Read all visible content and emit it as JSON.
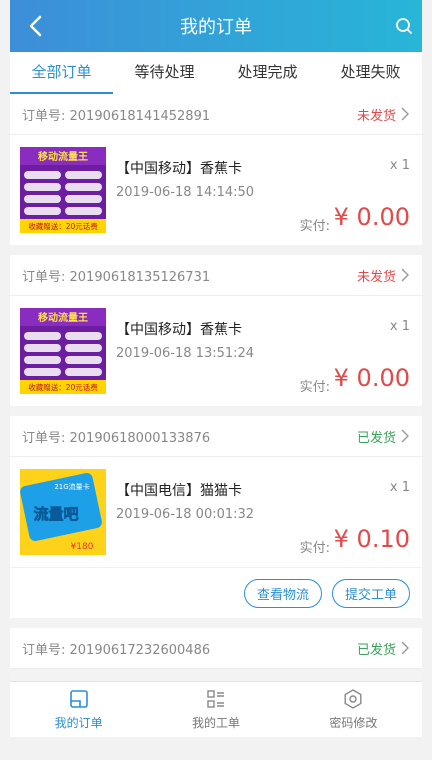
{
  "header": {
    "title": "我的订单"
  },
  "tabs": [
    "全部订单",
    "等待处理",
    "处理完成",
    "处理失败"
  ],
  "orders": [
    {
      "order_no": "订单号: 20190618141452891",
      "status": "未发货",
      "name": "【中国移动】香蕉卡",
      "date": "2019-06-18 14:14:50",
      "qty": "x 1",
      "pay_label": "实付:",
      "amount": "¥ 0.00",
      "thumb_title": "移动流量王",
      "thumb_bottom": "收藏赠送：20元话费"
    },
    {
      "order_no": "订单号: 20190618135126731",
      "status": "未发货",
      "name": "【中国移动】香蕉卡",
      "date": "2019-06-18 13:51:24",
      "qty": "x 1",
      "pay_label": "实付:",
      "amount": "¥ 0.00",
      "thumb_title": "移动流量王",
      "thumb_bottom": "收藏赠送：20元话费"
    },
    {
      "order_no": "订单号: 20190618000133876",
      "status": "已发货",
      "name": "【中国电信】猫猫卡",
      "date": "2019-06-18 00:01:32",
      "qty": "x 1",
      "pay_label": "实付:",
      "amount": "¥ 0.10",
      "thumb_top": "21G流量卡",
      "thumb_big": "流量吧",
      "thumb_price": "¥180",
      "actions": [
        "查看物流",
        "提交工单"
      ]
    },
    {
      "order_no": "订单号: 20190617232600486",
      "status": "已发货"
    }
  ],
  "tabbar": [
    {
      "label": "我的订单",
      "icon": "order-icon"
    },
    {
      "label": "我的工单",
      "icon": "ticket-list-icon"
    },
    {
      "label": "密码修改",
      "icon": "settings-icon"
    }
  ],
  "colors": {
    "accent": "#2b8fd6",
    "price": "#e24a4a",
    "shipped": "#3aa05a"
  }
}
